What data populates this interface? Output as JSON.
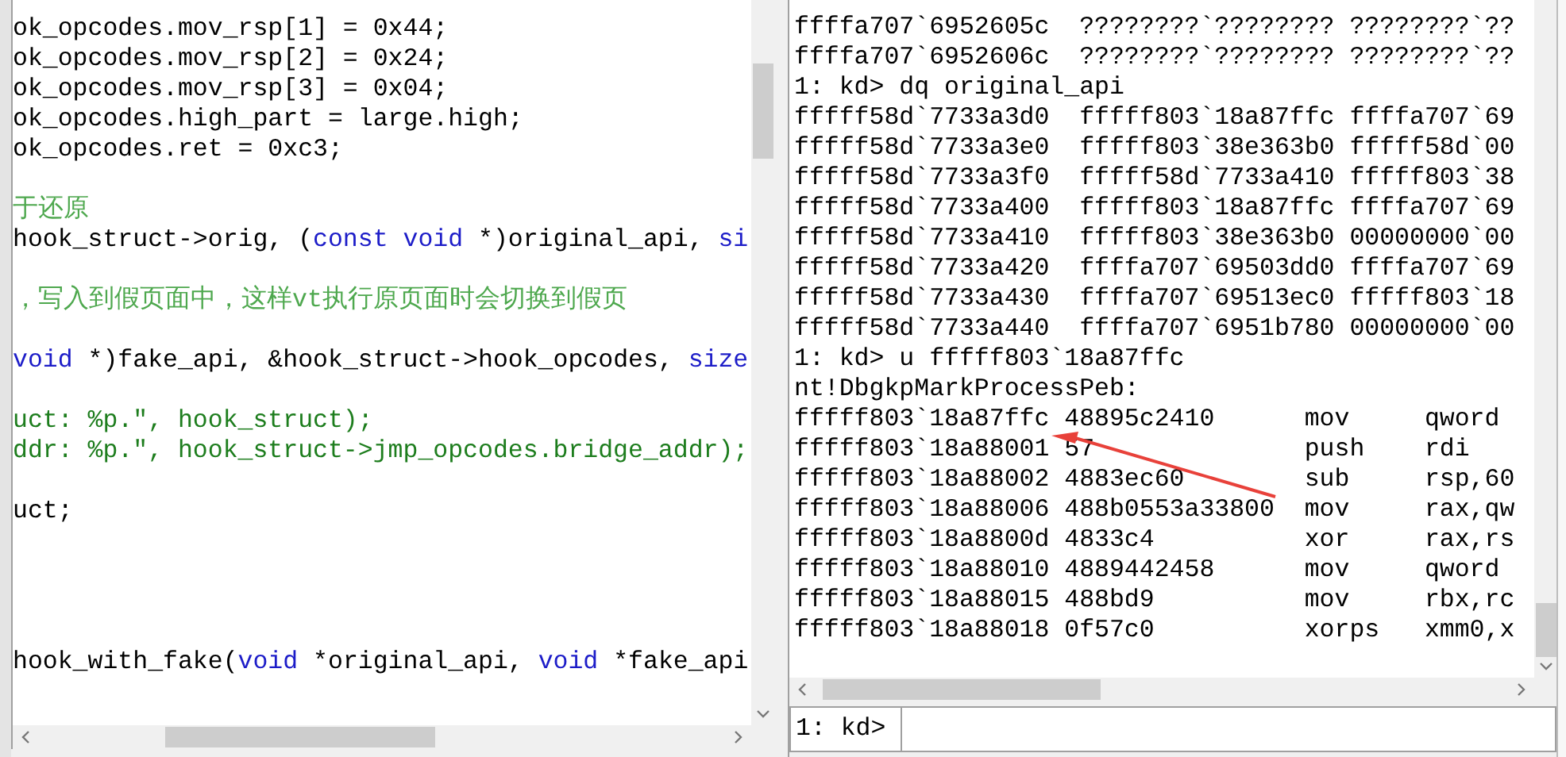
{
  "editor": {
    "lines": [
      {
        "kind": "code",
        "segments": [
          {
            "text": "ok_opcodes.mov_rsp[1] = 0x44;",
            "kind": "plain"
          }
        ]
      },
      {
        "kind": "code",
        "segments": [
          {
            "text": "ok_opcodes.mov_rsp[2] = 0x24;",
            "kind": "plain"
          }
        ]
      },
      {
        "kind": "code",
        "segments": [
          {
            "text": "ok_opcodes.mov_rsp[3] = 0x04;",
            "kind": "plain"
          }
        ]
      },
      {
        "kind": "code",
        "segments": [
          {
            "text": "ok_opcodes.high_part = large.high;",
            "kind": "plain"
          }
        ]
      },
      {
        "kind": "code",
        "segments": [
          {
            "text": "ok_opcodes.ret = 0xc3;",
            "kind": "plain"
          }
        ]
      },
      {
        "kind": "blank"
      },
      {
        "kind": "code",
        "segments": [
          {
            "text": "于还原",
            "kind": "comment"
          }
        ]
      },
      {
        "kind": "code",
        "segments": [
          {
            "text": "hook_struct->orig, (",
            "kind": "plain"
          },
          {
            "text": "const void",
            "kind": "keyword"
          },
          {
            "text": " *)original_api, ",
            "kind": "plain"
          },
          {
            "text": "si",
            "kind": "keyword"
          }
        ]
      },
      {
        "kind": "blank"
      },
      {
        "kind": "code",
        "segments": [
          {
            "text": "，写入到假页面中，这样vt执行原页面时会切换到假页",
            "kind": "comment"
          }
        ]
      },
      {
        "kind": "blank"
      },
      {
        "kind": "code",
        "segments": [
          {
            "text": "void",
            "kind": "keyword"
          },
          {
            "text": " *)fake_api, &hook_struct->hook_opcodes, ",
            "kind": "plain"
          },
          {
            "text": "size",
            "kind": "keyword"
          }
        ]
      },
      {
        "kind": "blank"
      },
      {
        "kind": "code",
        "segments": [
          {
            "text": "uct: %p.\", hook_struct);",
            "kind": "string"
          }
        ]
      },
      {
        "kind": "code",
        "segments": [
          {
            "text": "ddr: %p.\", hook_struct->jmp_opcodes.bridge_addr);",
            "kind": "string"
          }
        ]
      },
      {
        "kind": "blank"
      },
      {
        "kind": "code",
        "segments": [
          {
            "text": "uct;",
            "kind": "plain"
          }
        ]
      },
      {
        "kind": "blank"
      },
      {
        "kind": "blank"
      },
      {
        "kind": "blank"
      },
      {
        "kind": "blank"
      },
      {
        "kind": "code",
        "segments": [
          {
            "text": "hook_with_fake(",
            "kind": "plain"
          },
          {
            "text": "void",
            "kind": "keyword"
          },
          {
            "text": " *original_api, ",
            "kind": "plain"
          },
          {
            "text": "void",
            "kind": "keyword"
          },
          {
            "text": " *fake_api",
            "kind": "plain"
          }
        ]
      }
    ]
  },
  "output": {
    "lines": [
      {
        "kind": "text",
        "text": "ffffa707`6952605c  ????????`???????? ????????`??"
      },
      {
        "kind": "text",
        "text": "ffffa707`6952606c  ????????`???????? ????????`??"
      },
      {
        "kind": "text",
        "text": "1: kd> dq original_api"
      },
      {
        "kind": "text",
        "text": "fffff58d`7733a3d0  fffff803`18a87ffc ffffa707`69"
      },
      {
        "kind": "text",
        "text": "fffff58d`7733a3e0  fffff803`38e363b0 fffff58d`00"
      },
      {
        "kind": "text",
        "text": "fffff58d`7733a3f0  fffff58d`7733a410 fffff803`38"
      },
      {
        "kind": "text",
        "text": "fffff58d`7733a400  fffff803`18a87ffc ffffa707`69"
      },
      {
        "kind": "text",
        "text": "fffff58d`7733a410  fffff803`38e363b0 00000000`00"
      },
      {
        "kind": "text",
        "text": "fffff58d`7733a420  ffffa707`69503dd0 ffffa707`69"
      },
      {
        "kind": "text",
        "text": "fffff58d`7733a430  ffffa707`69513ec0 fffff803`18"
      },
      {
        "kind": "text",
        "text": "fffff58d`7733a440  ffffa707`6951b780 00000000`00"
      },
      {
        "kind": "text",
        "text": "1: kd> u fffff803`18a87ffc"
      },
      {
        "kind": "text",
        "text": "nt!DbgkpMarkProcessPeb:"
      },
      {
        "kind": "disasm",
        "address": "fffff803`18a87ffc",
        "bytes": "48895c2410",
        "mnemonic": "mov",
        "operands": "qword"
      },
      {
        "kind": "disasm",
        "address": "fffff803`18a88001",
        "bytes": "57",
        "mnemonic": "push",
        "operands": "rdi"
      },
      {
        "kind": "disasm",
        "address": "fffff803`18a88002",
        "bytes": "4883ec60",
        "mnemonic": "sub",
        "operands": "rsp,60"
      },
      {
        "kind": "disasm",
        "address": "fffff803`18a88006",
        "bytes": "488b0553a33800",
        "mnemonic": "mov",
        "operands": "rax,qw"
      },
      {
        "kind": "disasm",
        "address": "fffff803`18a8800d",
        "bytes": "4833c4",
        "mnemonic": "xor",
        "operands": "rax,rs"
      },
      {
        "kind": "disasm",
        "address": "fffff803`18a88010",
        "bytes": "4889442458",
        "mnemonic": "mov",
        "operands": "qword"
      },
      {
        "kind": "disasm",
        "address": "fffff803`18a88015",
        "bytes": "488bd9",
        "mnemonic": "mov",
        "operands": "rbx,rc"
      },
      {
        "kind": "disasm",
        "address": "fffff803`18a88018",
        "bytes": "0f57c0",
        "mnemonic": "xorps",
        "operands": "xmm0,x"
      }
    ]
  },
  "command": {
    "prompt": "1: kd>"
  }
}
